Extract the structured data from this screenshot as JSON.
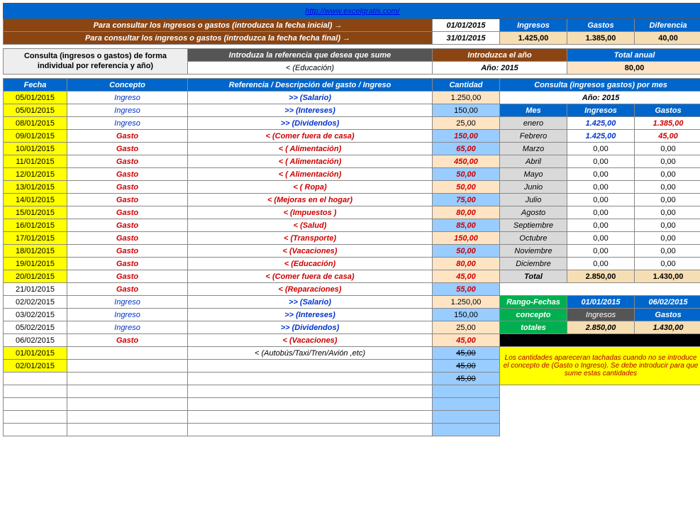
{
  "url": "http://www.excelgratis.com/",
  "consult": {
    "row1": "Para consultar los ingresos o gastos (introduzca la fecha inicial) →",
    "row2": "Para consultar los ingresos o gastos (introduzca la fecha fecha final) →",
    "date1": "01/01/2015",
    "date2": "31/01/2015",
    "h_ing": "Ingresos",
    "h_gas": "Gastos",
    "h_dif": "Diferencia",
    "v_ing": "1.425,00",
    "v_gas": "1.385,00",
    "v_dif": "40,00"
  },
  "ref": {
    "label": "Consulta (ingresos o gastos) de forma individual  por referencia y año)",
    "intro_ref": "Introduza la referencia que desea que sume",
    "intro_year": "Introduzca el año",
    "total_anual": "Total anual",
    "ref_val": "<   (Educación)",
    "year_lbl": "Año:    2015",
    "total_val": "80,00"
  },
  "cols": {
    "fecha": "Fecha",
    "concepto": "Concepto",
    "ref": "Referencia / Descripción del gasto / Ingreso",
    "cant": "Cantidad",
    "consulta": "Consulta (ingresos gastos) por mes"
  },
  "rows": [
    {
      "f": "05/01/2015",
      "c": "Ingreso",
      "r": ">>  (Salario)",
      "q": "1.250,00",
      "t": "ing",
      "y": 1,
      "p": 1
    },
    {
      "f": "05/01/2015",
      "c": "Ingreso",
      "r": ">>  (Intereses)",
      "q": "150,00",
      "t": "ing",
      "y": 1
    },
    {
      "f": "08/01/2015",
      "c": "Ingreso",
      "r": ">>  (Dividendos)",
      "q": "25,00",
      "t": "ing",
      "y": 1,
      "p": 1
    },
    {
      "f": "09/01/2015",
      "c": "Gasto",
      "r": "<  (Comer fuera de casa)",
      "q": "150,00",
      "t": "gas",
      "y": 1
    },
    {
      "f": "10/01/2015",
      "c": "Gasto",
      "r": "<  ( Alimentación)",
      "q": "65,00",
      "t": "gas",
      "y": 1
    },
    {
      "f": "11/01/2015",
      "c": "Gasto",
      "r": "<  ( Alimentación)",
      "q": "450,00",
      "t": "gas",
      "y": 1,
      "p": 1
    },
    {
      "f": "12/01/2015",
      "c": "Gasto",
      "r": "<  ( Alimentación)",
      "q": "50,00",
      "t": "gas",
      "y": 1
    },
    {
      "f": "13/01/2015",
      "c": "Gasto",
      "r": "<  ( Ropa)",
      "q": "50,00",
      "t": "gas",
      "y": 1,
      "p": 1
    },
    {
      "f": "14/01/2015",
      "c": "Gasto",
      "r": "<  (Mejoras en el hogar)",
      "q": "75,00",
      "t": "gas",
      "y": 1
    },
    {
      "f": "15/01/2015",
      "c": "Gasto",
      "r": "<  (Impuestos )",
      "q": "80,00",
      "t": "gas",
      "y": 1,
      "p": 1
    },
    {
      "f": "16/01/2015",
      "c": "Gasto",
      "r": "<  (Salud)",
      "q": "85,00",
      "t": "gas",
      "y": 1
    },
    {
      "f": "17/01/2015",
      "c": "Gasto",
      "r": "<  (Transporte)",
      "q": "150,00",
      "t": "gas",
      "y": 1,
      "p": 1
    },
    {
      "f": "18/01/2015",
      "c": "Gasto",
      "r": "<  (Vacaciones)",
      "q": "50,00",
      "t": "gas",
      "y": 1
    },
    {
      "f": "19/01/2015",
      "c": "Gasto",
      "r": "<  (Educación)",
      "q": "80,00",
      "t": "gas",
      "y": 1,
      "p": 1
    },
    {
      "f": "20/01/2015",
      "c": "Gasto",
      "r": "<  (Comer fuera de casa)",
      "q": "45,00",
      "t": "gas",
      "y": 1,
      "p": 1
    },
    {
      "f": "21/01/2015",
      "c": "Gasto",
      "r": "<  (Reparaciones)",
      "q": "55,00",
      "t": "gas"
    },
    {
      "f": "02/02/2015",
      "c": "Ingreso",
      "r": ">>  (Salario)",
      "q": "1.250,00",
      "t": "ing",
      "p": 1
    },
    {
      "f": "03/02/2015",
      "c": "Ingreso",
      "r": ">>  (Intereses)",
      "q": "150,00",
      "t": "ing"
    },
    {
      "f": "05/02/2015",
      "c": "Ingreso",
      "r": ">>  (Dividendos)",
      "q": "25,00",
      "t": "ing",
      "p": 1
    },
    {
      "f": "06/02/2015",
      "c": "Gasto",
      "r": "<  (Vacaciones)",
      "q": "45,00",
      "t": "gas",
      "p": 1
    },
    {
      "f": "01/01/2015",
      "c": "",
      "r": "<  (Autobús/Taxi/Tren/Avión ,etc)",
      "q": "45,00",
      "t": "none",
      "y": 1,
      "s": 1
    },
    {
      "f": "02/01/2015",
      "c": "",
      "r": "",
      "q": "45,00",
      "t": "none",
      "y": 1,
      "s": 1
    },
    {
      "f": "",
      "c": "",
      "r": "",
      "q": "45,00",
      "t": "none",
      "s": 1
    },
    {
      "f": "",
      "c": "",
      "r": "",
      "q": "",
      "t": "none"
    },
    {
      "f": "",
      "c": "",
      "r": "",
      "q": "",
      "t": "none"
    },
    {
      "f": "",
      "c": "",
      "r": "",
      "q": "",
      "t": "none"
    },
    {
      "f": "",
      "c": "",
      "r": "",
      "q": "",
      "t": "none"
    }
  ],
  "monthly": {
    "year": "Año:    2015",
    "h_mes": "Mes",
    "h_ing": "Ingresos",
    "h_gas": "Gastos",
    "rows": [
      {
        "m": "enero",
        "i": "1.425,00",
        "g": "1.385,00",
        "hl": 1
      },
      {
        "m": "Febrero",
        "i": "1.425,00",
        "g": "45,00",
        "hl": 1
      },
      {
        "m": "Marzo",
        "i": "0,00",
        "g": "0,00"
      },
      {
        "m": "Abril",
        "i": "0,00",
        "g": "0,00"
      },
      {
        "m": "Mayo",
        "i": "0,00",
        "g": "0,00"
      },
      {
        "m": "Junio",
        "i": "0,00",
        "g": "0,00"
      },
      {
        "m": "Julio",
        "i": "0,00",
        "g": "0,00"
      },
      {
        "m": "Agosto",
        "i": "0,00",
        "g": "0,00"
      },
      {
        "m": "Septiembre",
        "i": "0,00",
        "g": "0,00"
      },
      {
        "m": "Octubre",
        "i": "0,00",
        "g": "0,00"
      },
      {
        "m": "Noviembre",
        "i": "0,00",
        "g": "0,00"
      },
      {
        "m": "Diciembre",
        "i": "0,00",
        "g": "0,00"
      }
    ],
    "total_lbl": "Total",
    "total_i": "2.850,00",
    "total_g": "1.430,00"
  },
  "range": {
    "h1": "Rango-Fechas",
    "d1": "01/01/2015",
    "d2": "06/02/2015",
    "h2": "concepto",
    "c1": "Ingresos",
    "c2": "Gastos",
    "h3": "totales",
    "t1": "2.850,00",
    "t2": "1.430,00"
  },
  "note": "Los cantidades apareceran tachadas cuando no se introduce el concepto de (Gasto o Ingreso).  Se debe introducir para que sume estas cantidades"
}
